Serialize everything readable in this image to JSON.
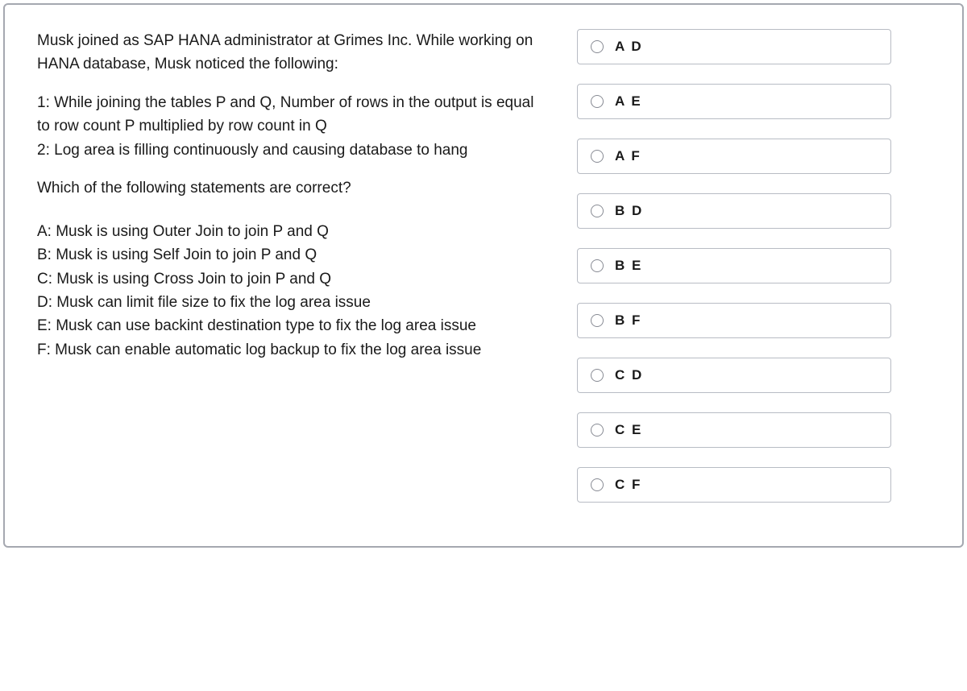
{
  "question": {
    "intro": "Musk joined as SAP HANA administrator at Grimes Inc. While working on HANA database, Musk noticed the following:",
    "observation1": "1: While joining the tables P and Q, Number of rows in the output is equal to row count P multiplied by row count in Q",
    "observation2": "2: Log area is filling continuously and causing database to hang",
    "prompt": "Which of the following statements are correct?",
    "optionA": "A: Musk is using Outer Join to join P and Q",
    "optionB": "B: Musk is using Self Join to join P and Q",
    "optionC": "C: Musk is using Cross Join to join P and Q",
    "optionD": "D: Musk can limit file size to fix the log area issue",
    "optionE": "E: Musk can use backint destination type to fix the log area issue",
    "optionF": "F: Musk can enable automatic log backup to fix the log area issue"
  },
  "answers": [
    {
      "label": "A D"
    },
    {
      "label": "A E"
    },
    {
      "label": "A F"
    },
    {
      "label": "B D"
    },
    {
      "label": "B E"
    },
    {
      "label": "B F"
    },
    {
      "label": "C D"
    },
    {
      "label": "C E"
    },
    {
      "label": "C F"
    }
  ]
}
